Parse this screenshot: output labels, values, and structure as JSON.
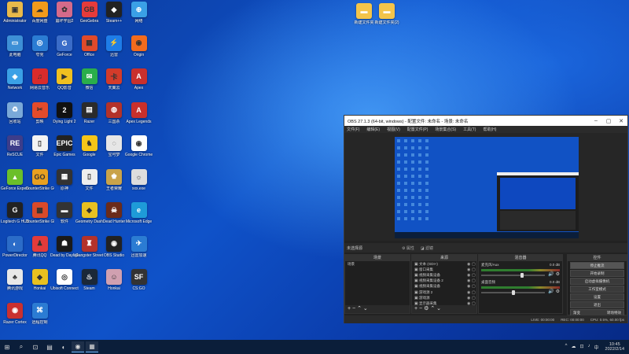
{
  "desktop": {
    "icons": [
      {
        "label": "Administrator",
        "color": "#e8b94a",
        "glyph": "▣"
      },
      {
        "label": "百度网盘",
        "color": "#f29a1b",
        "glyph": "☁"
      },
      {
        "label": "崩坏学园2",
        "color": "#d56a8a",
        "glyph": "✿"
      },
      {
        "label": "GeoGebra",
        "color": "#e63b3b",
        "glyph": "GB"
      },
      {
        "label": "Steam++",
        "color": "#222",
        "glyph": "◆"
      },
      {
        "label": "网络",
        "color": "#3aa0e6",
        "glyph": "⊕"
      },
      {
        "label": "此电脑",
        "color": "#3d8fd6",
        "glyph": "▭"
      },
      {
        "label": "夸克",
        "color": "#2b7cd3",
        "glyph": "◎"
      },
      {
        "label": "GeForce",
        "color": "#3a6cc8",
        "glyph": "G"
      },
      {
        "label": "Office",
        "color": "#e04a2a",
        "glyph": "▦"
      },
      {
        "label": "迅雷",
        "color": "#1e7de8",
        "glyph": "⚡"
      },
      {
        "label": "Origin",
        "color": "#f26b1d",
        "glyph": "◉"
      },
      {
        "label": "Network",
        "color": "#3aa0e6",
        "glyph": "◈"
      },
      {
        "label": "网易云音乐",
        "color": "#d92b2b",
        "glyph": "♫"
      },
      {
        "label": "QQ影音",
        "color": "#f0c020",
        "glyph": "▶"
      },
      {
        "label": "微信",
        "color": "#2aae4b",
        "glyph": "✉"
      },
      {
        "label": "天翼云",
        "color": "#d43b2a",
        "glyph": "卡"
      },
      {
        "label": "Apex",
        "color": "#c9302c",
        "glyph": "A"
      },
      {
        "label": "回收站",
        "color": "#7aa9d8",
        "glyph": "♻"
      },
      {
        "label": "剪映",
        "color": "#e34b2b",
        "glyph": "✂"
      },
      {
        "label": "Dying Light 2",
        "color": "#111",
        "glyph": "2"
      },
      {
        "label": "Razer",
        "color": "#2b2b2b",
        "glyph": "▤"
      },
      {
        "label": "三国杀",
        "color": "#b3322a",
        "glyph": "◍"
      },
      {
        "label": "Apex Legends",
        "color": "#c9302c",
        "glyph": "A"
      },
      {
        "label": "ReSCUE",
        "color": "#3d3d8a",
        "glyph": "RE"
      },
      {
        "label": "文件",
        "color": "#f3f3f3",
        "glyph": "▯"
      },
      {
        "label": "Epic Games",
        "color": "#222",
        "glyph": "EPIC"
      },
      {
        "label": "Google",
        "color": "#f5c518",
        "glyph": "♞"
      },
      {
        "label": "宝可梦",
        "color": "#e6e6e6",
        "glyph": "◌"
      },
      {
        "label": "Google Chrome",
        "color": "#fff",
        "glyph": "◉"
      },
      {
        "label": "GeForce Experience",
        "color": "#6bbf2a",
        "glyph": "▲"
      },
      {
        "label": "CounterStrike GO",
        "color": "#e8a020",
        "glyph": "GO"
      },
      {
        "label": "原神",
        "color": "#333",
        "glyph": "▦"
      },
      {
        "label": "文件",
        "color": "#eee",
        "glyph": "▯"
      },
      {
        "label": "王者荣耀",
        "color": "#c9a34a",
        "glyph": "♚"
      },
      {
        "label": "xxx.exe",
        "color": "#ddd",
        "glyph": "☼"
      },
      {
        "label": "Logitech G HUB",
        "color": "#222",
        "glyph": "G"
      },
      {
        "label": "CounterStrike Global",
        "color": "#d94a2a",
        "glyph": "▩"
      },
      {
        "label": "软件",
        "color": "#333",
        "glyph": "▬"
      },
      {
        "label": "Geometry Dash",
        "color": "#e8c020",
        "glyph": "◆"
      },
      {
        "label": "Dead Hunter",
        "color": "#6b2b1a",
        "glyph": "☠"
      },
      {
        "label": "Microsoft Edge",
        "color": "#1e9bd8",
        "glyph": "e"
      },
      {
        "label": "PowerDirector",
        "color": "#2b6cc8",
        "glyph": "◐"
      },
      {
        "label": "腾讯QQ",
        "color": "#e23b3b",
        "glyph": "♟"
      },
      {
        "label": "Dead by Daylight",
        "color": "#1a1a1a",
        "glyph": "☗"
      },
      {
        "label": "Gangster Street",
        "color": "#b3322a",
        "glyph": "♜"
      },
      {
        "label": "OBS Studio",
        "color": "#222",
        "glyph": "◉"
      },
      {
        "label": "迅雷加速",
        "color": "#2b7cd3",
        "glyph": "✈"
      },
      {
        "label": "腾讯游戏",
        "color": "#e8e8e8",
        "glyph": "♣"
      },
      {
        "label": "Honkai",
        "color": "#e8c020",
        "glyph": "◆"
      },
      {
        "label": "Ubisoft Connect",
        "color": "#fff",
        "glyph": "◎"
      },
      {
        "label": "Steam",
        "color": "#1b2838",
        "glyph": "♨"
      },
      {
        "label": "Honkai",
        "color": "#d0a0b0",
        "glyph": "☺"
      },
      {
        "label": "CS:GO",
        "color": "#333",
        "glyph": "SF"
      },
      {
        "label": "Razer Cortex",
        "color": "#c93030",
        "glyph": "◉"
      },
      {
        "label": "远程控制",
        "color": "#2b7cd3",
        "glyph": "⌘"
      }
    ],
    "folders": [
      {
        "label": "新建文件夹"
      },
      {
        "label": "新建文件夹(2)"
      }
    ]
  },
  "obs": {
    "title": "OBS 27.1.3 (64-bit, windows) - 配置文件: 未命名 - 场景: 未命名",
    "menu": [
      "文件(F)",
      "编辑(E)",
      "视图(V)",
      "配置文件(P)",
      "场景集合(S)",
      "工具(T)",
      "帮助(H)"
    ],
    "scene_bar": {
      "label": "未选择源",
      "properties": "属性",
      "filters": "滤镜"
    },
    "docks": {
      "scenes": {
        "header": "场景",
        "items": [
          "场景"
        ]
      },
      "sources": {
        "header": "来源",
        "items": [
          "文本 (GDI+)",
          "窗口采集",
          "视频采集设备",
          "视频采集设备 2",
          "视频采集设备",
          "游戏源 2",
          "游戏源",
          "显示器采集"
        ]
      },
      "mixer": {
        "header": "混音器",
        "channels": [
          {
            "name": "麦克风/Aux",
            "db": "0.0 dB",
            "level": 0.62
          },
          {
            "name": "桌面音频",
            "db": "0.0 dB",
            "level": 0.48
          }
        ]
      },
      "controls": {
        "header": "控件",
        "buttons": [
          "停止推流",
          "开始录制",
          "启动虚拟摄像机",
          "工作室模式",
          "设置",
          "退出"
        ]
      }
    },
    "transitions": {
      "fade": "渐变",
      "duration": "转场特效"
    },
    "status": {
      "live": "LIVE: 00:00:00",
      "rec": "REC: 00:00:00",
      "cpu": "CPU: 0.5%, 60.00 fps"
    }
  },
  "taskbar": {
    "apps": [
      "⊞",
      "⌕",
      "⊡",
      "▤",
      "◐",
      "◉",
      "▦"
    ],
    "tray": [
      "^",
      "☁",
      "⊡",
      "♪",
      "中"
    ],
    "time": "10:45",
    "date": "2022/2/14"
  }
}
